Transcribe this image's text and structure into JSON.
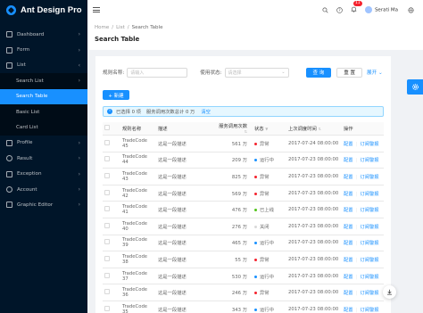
{
  "app": {
    "title": "Ant Design Pro"
  },
  "sider": {
    "items": [
      {
        "label": "Dashboard",
        "icon": "dashboard-icon",
        "arrow": "›"
      },
      {
        "label": "Form",
        "icon": "form-icon",
        "arrow": "›"
      },
      {
        "label": "List",
        "icon": "table-icon",
        "arrow": "‹"
      },
      {
        "label": "Search List",
        "sub": true,
        "arrow": "›"
      },
      {
        "label": "Search Table",
        "sub": true,
        "selected": true
      },
      {
        "label": "Basic List",
        "sub": true
      },
      {
        "label": "Card List",
        "sub": true
      },
      {
        "label": "Profile",
        "icon": "profile-icon",
        "arrow": "›"
      },
      {
        "label": "Result",
        "icon": "check-circle-icon",
        "arrow": "›"
      },
      {
        "label": "Exception",
        "icon": "warning-icon",
        "arrow": "›"
      },
      {
        "label": "Account",
        "icon": "user-icon",
        "arrow": "›"
      },
      {
        "label": "Graphic Editor",
        "icon": "highlight-icon",
        "arrow": "›"
      }
    ]
  },
  "header": {
    "notification_count": "11",
    "username": "Serati Ma"
  },
  "breadcrumb": {
    "home": "Home",
    "list": "List",
    "current": "Search Table"
  },
  "page": {
    "title": "Search Table"
  },
  "filters": {
    "rule_label": "规则名称:",
    "rule_placeholder": "请输入",
    "status_label": "使用状态:",
    "status_placeholder": "请选择",
    "query_button": "查 询",
    "reset_button": "重 置",
    "expand_link": "展开"
  },
  "toolbar": {
    "new_button": "+ 新建"
  },
  "alert": {
    "selected_text": "已选择 0 项",
    "total_text": "服务调用次数总计 0 万",
    "clear_link": "清空"
  },
  "table": {
    "columns": [
      "规则名称",
      "描述",
      "服务调用次数",
      "状态",
      "上次调度时间",
      "操作"
    ],
    "op_config": "配置",
    "op_subscribe": "订阅警报",
    "rows": [
      {
        "name": "TradeCode 45",
        "desc": "这是一段描述",
        "calls": "561 万",
        "status": "异常",
        "status_color": "#f5222d",
        "time": "2017-07-24 08:00:00"
      },
      {
        "name": "TradeCode 44",
        "desc": "这是一段描述",
        "calls": "209 万",
        "status": "运行中",
        "status_color": "#1890ff",
        "time": "2017-07-23 08:00:00"
      },
      {
        "name": "TradeCode 43",
        "desc": "这是一段描述",
        "calls": "825 万",
        "status": "异常",
        "status_color": "#f5222d",
        "time": "2017-07-23 08:00:00"
      },
      {
        "name": "TradeCode 42",
        "desc": "这是一段描述",
        "calls": "569 万",
        "status": "异常",
        "status_color": "#f5222d",
        "time": "2017-07-23 08:00:00"
      },
      {
        "name": "TradeCode 41",
        "desc": "这是一段描述",
        "calls": "476 万",
        "status": "已上线",
        "status_color": "#52c41a",
        "time": "2017-07-23 08:00:00"
      },
      {
        "name": "TradeCode 40",
        "desc": "这是一段描述",
        "calls": "276 万",
        "status": "关闭",
        "status_color": "#d9d9d9",
        "time": "2017-07-23 08:00:00"
      },
      {
        "name": "TradeCode 39",
        "desc": "这是一段描述",
        "calls": "465 万",
        "status": "运行中",
        "status_color": "#1890ff",
        "time": "2017-07-23 08:00:00"
      },
      {
        "name": "TradeCode 38",
        "desc": "这是一段描述",
        "calls": "55 万",
        "status": "异常",
        "status_color": "#f5222d",
        "time": "2017-07-23 08:00:00"
      },
      {
        "name": "TradeCode 37",
        "desc": "这是一段描述",
        "calls": "530 万",
        "status": "运行中",
        "status_color": "#1890ff",
        "time": "2017-07-23 08:00:00"
      },
      {
        "name": "TradeCode 36",
        "desc": "这是一段描述",
        "calls": "246 万",
        "status": "异常",
        "status_color": "#f5222d",
        "time": "2017-07-23 08:00:00"
      },
      {
        "name": "TradeCode 35",
        "desc": "这是一段描述",
        "calls": "343 万",
        "status": "运行中",
        "status_color": "#1890ff",
        "time": "2017-07-23 08:00:00"
      }
    ]
  },
  "colors": {
    "primary": "#1890ff",
    "sider": "#001529"
  }
}
